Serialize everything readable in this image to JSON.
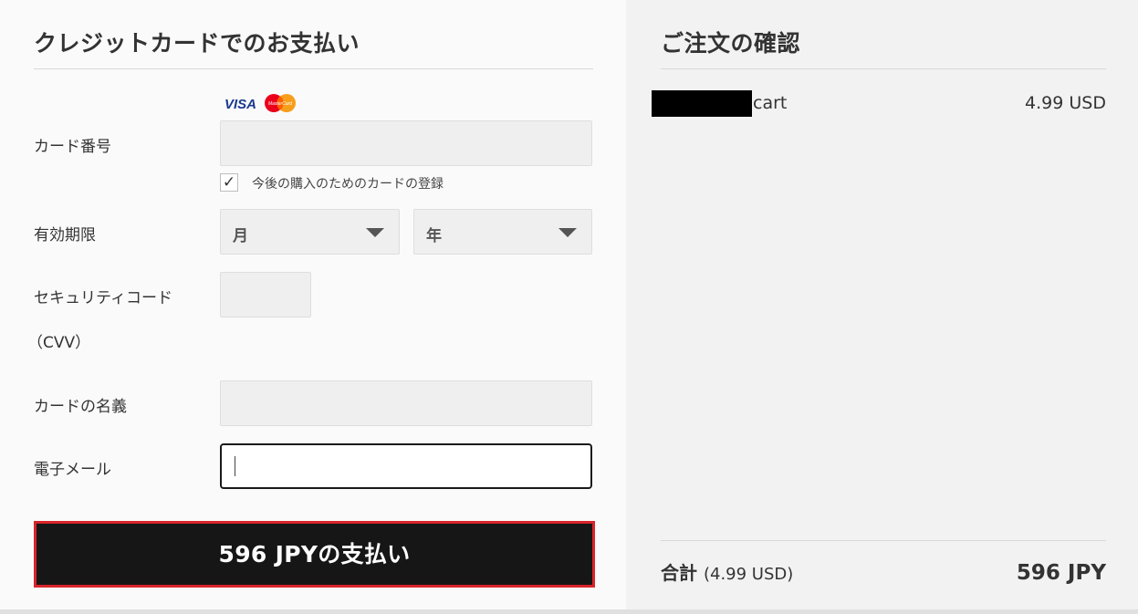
{
  "payment": {
    "heading": "クレジットカードでのお支払い",
    "card_number_label": "カード番号",
    "card_number_value": "",
    "card_brands": [
      "VISA",
      "MasterCard"
    ],
    "save_card_label": "今後の購入のためのカードの登録",
    "save_card_checked": true,
    "expiry_label": "有効期限",
    "expiry_month_value": "月",
    "expiry_year_value": "年",
    "cvv_label_line1": "セキュリティコード",
    "cvv_label_line2": "（CVV）",
    "cvv_value": "",
    "card_name_label": "カードの名義",
    "card_name_value": "",
    "email_label": "電子メール",
    "email_value": "",
    "pay_button_label": "596 JPYの支払い"
  },
  "order": {
    "heading": "ご注文の確認",
    "items": [
      {
        "name": "cart",
        "price": "4.99 USD"
      }
    ],
    "total_label": "合計",
    "total_sub": "(4.99 USD)",
    "total_value": "596 JPY"
  },
  "colors": {
    "pay_button_bg": "#161616",
    "pay_button_border": "#d9242a",
    "left_panel_bg": "#fafafa",
    "right_panel_bg": "#f2f2f2",
    "input_bg": "#efefef"
  }
}
